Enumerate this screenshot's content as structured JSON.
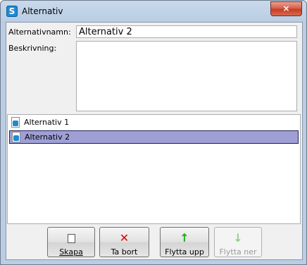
{
  "window": {
    "title": "Alternativ",
    "close_label": "×"
  },
  "form": {
    "name_label": "Alternativnamn:",
    "name_value": "Alternativ 2",
    "description_label": "Beskrivning:",
    "description_value": ""
  },
  "list": {
    "items": [
      {
        "label": "Alternativ 1",
        "selected": false
      },
      {
        "label": "Alternativ 2",
        "selected": true
      }
    ]
  },
  "toolbar": {
    "create_label": "Skapa",
    "delete_label": "Ta bort",
    "move_up_label": "Flytta upp",
    "move_down_label": "Flytta ner"
  },
  "icons": {
    "app": "app-logo-icon",
    "create": "new-document-icon",
    "delete": "red-x-icon",
    "move_up": "green-up-arrow-icon",
    "move_down": "green-down-arrow-icon",
    "list_item": "alternative-item-icon"
  },
  "colors": {
    "selection": "#9f9fd6",
    "close_button": "#c43d24",
    "frame": "#b9cde4"
  }
}
